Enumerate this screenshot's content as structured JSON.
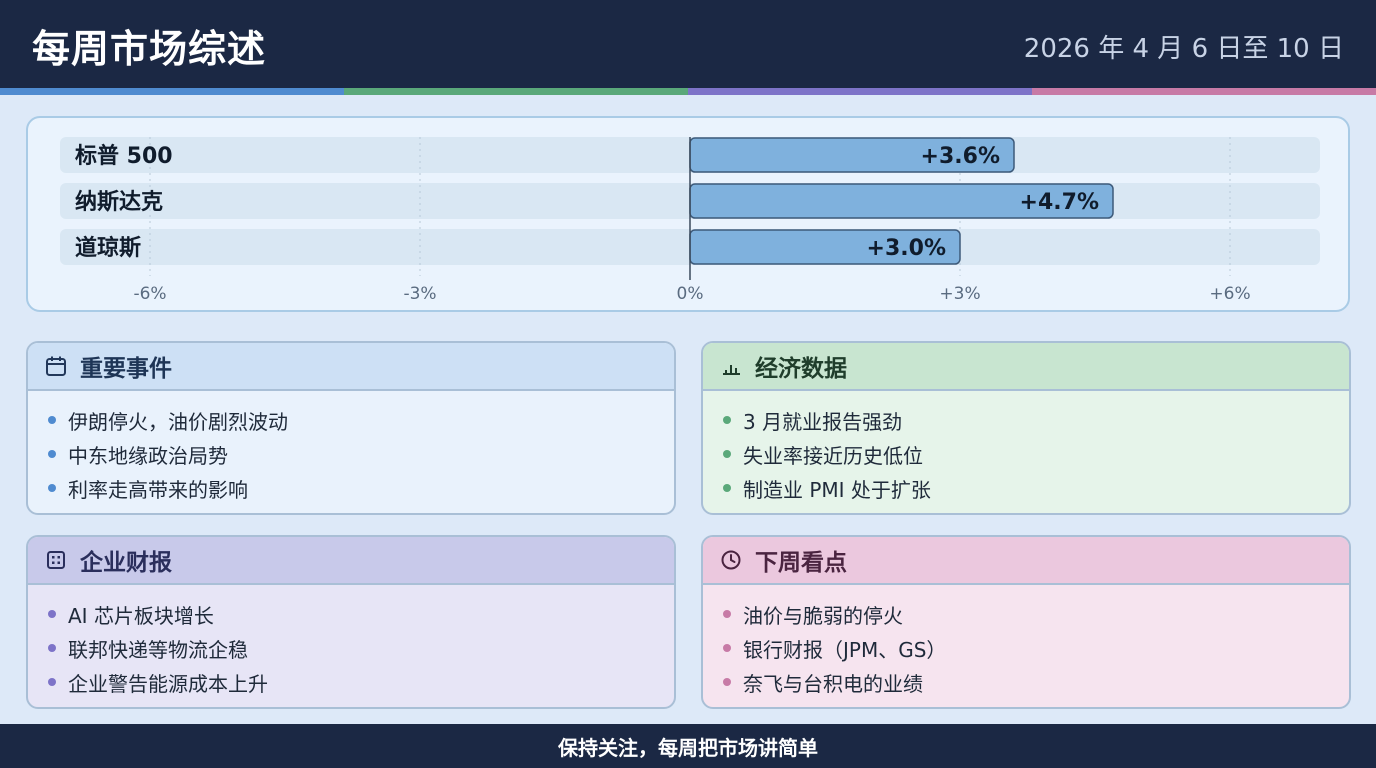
{
  "header": {
    "title": "每周市场综述",
    "date_range": "2026 年 4 月 6 日至 10 日"
  },
  "colors": {
    "header_bg": "#1b2844",
    "stripe_blue": "#4f8bd0",
    "stripe_green": "#5aa87a",
    "stripe_purple": "#7d73c8",
    "stripe_pink": "#c77aa6",
    "bar_fill": "#7fb1dd",
    "bar_stroke": "#3d5a7a"
  },
  "chart_data": {
    "type": "bar",
    "orientation": "horizontal",
    "categories": [
      "标普 500",
      "纳斯达克",
      "道琼斯"
    ],
    "values": [
      3.6,
      4.7,
      3.0
    ],
    "value_labels": [
      "+3.6%",
      "+4.7%",
      "+3.0%"
    ],
    "xlim": [
      -7,
      7
    ],
    "ticks": [
      -6,
      -3,
      0,
      3,
      6
    ],
    "tick_labels": [
      "-6%",
      "-3%",
      "0%",
      "+3%",
      "+6%"
    ],
    "grid": true,
    "title": "",
    "xlabel": "",
    "ylabel": ""
  },
  "panels": {
    "events": {
      "title": "重要事件",
      "icon": "calendar-icon",
      "accent": "#4f8bd0",
      "items": [
        "伊朗停火，油价剧烈波动",
        "中东地缘政治局势",
        "利率走高带来的影响"
      ]
    },
    "economy": {
      "title": "经济数据",
      "icon": "bar-chart-icon",
      "accent": "#5aa87a",
      "items": [
        "3 月就业报告强劲",
        "失业率接近历史低位",
        "制造业 PMI 处于扩张"
      ]
    },
    "earnings": {
      "title": "企业财报",
      "icon": "building-icon",
      "accent": "#7d73c8",
      "items": [
        "AI 芯片板块增长",
        "联邦快递等物流企稳",
        "企业警告能源成本上升"
      ]
    },
    "next_week": {
      "title": "下周看点",
      "icon": "clock-icon",
      "accent": "#c77aa6",
      "items": [
        "油价与脆弱的停火",
        "银行财报（JPM、GS）",
        "奈飞与台积电的业绩"
      ]
    }
  },
  "footer": {
    "text": "保持关注，每周把市场讲简单"
  }
}
